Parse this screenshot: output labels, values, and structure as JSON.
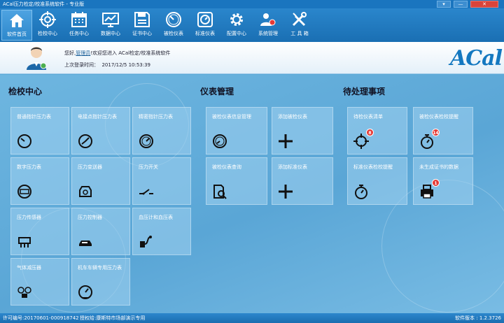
{
  "window": {
    "title": "ACal压力检定/校准系统软件 - 专业版",
    "controls": [
      "▾",
      "—",
      "✕"
    ]
  },
  "toolbar": [
    {
      "label": "软件首页",
      "icon": "home-icon",
      "active": true
    },
    {
      "label": "检校中心",
      "icon": "target-icon"
    },
    {
      "label": "任务中心",
      "icon": "calendar-icon"
    },
    {
      "label": "数据中心",
      "icon": "monitor-chart-icon"
    },
    {
      "label": "证书中心",
      "icon": "floppy-icon"
    },
    {
      "label": "被检仪表",
      "icon": "gauge-icon"
    },
    {
      "label": "标准仪表",
      "icon": "standard-gauge-icon"
    },
    {
      "label": "配置中心",
      "icon": "gear-icon"
    },
    {
      "label": "系统管理",
      "icon": "users-icon"
    },
    {
      "label": "工 具 箱",
      "icon": "tools-icon"
    }
  ],
  "header": {
    "greeting": "您好,",
    "username": "管理员",
    "welcome": "!欢迎您进入 ACal检定/校准系统软件",
    "last_login_label": "上次登录时间：",
    "last_login_value": "2017/12/5 10:53:39",
    "logo": "ACal"
  },
  "sections": {
    "calibration": {
      "title": "检校中心",
      "tiles": [
        {
          "label": "普通指针压力表",
          "icon": "pointer-gauge-icon"
        },
        {
          "label": "电接点指针压力表",
          "icon": "contact-gauge-icon"
        },
        {
          "label": "精密指针压力表",
          "icon": "precision-gauge-icon"
        },
        {
          "label": "数字压力表",
          "icon": "digital-gauge-icon"
        },
        {
          "label": "压力变送器",
          "icon": "transmitter-icon"
        },
        {
          "label": "压力开关",
          "icon": "switch-icon"
        },
        {
          "label": "压力传感器",
          "icon": "sensor-icon"
        },
        {
          "label": "压力控制器",
          "icon": "controller-icon"
        },
        {
          "label": "血压计和血压表",
          "icon": "blood-pressure-icon"
        },
        {
          "label": "气体减压器",
          "icon": "reducer-icon"
        },
        {
          "label": "机车车辆专用压力表",
          "icon": "locomotive-gauge-icon"
        }
      ]
    },
    "instruments": {
      "title": "仪表管理",
      "tiles": [
        {
          "label": "被检仪表信息管理",
          "icon": "gauge-info-icon"
        },
        {
          "label": "添加被检仪表",
          "icon": "plus-icon"
        },
        {
          "label": "被检仪表查询",
          "icon": "search-doc-icon"
        },
        {
          "label": "添加标准仪表",
          "icon": "plus-icon"
        }
      ]
    },
    "pending": {
      "title": "待处理事项",
      "tiles": [
        {
          "label": "待检仪表清单",
          "icon": "crosshair-icon",
          "badge": "8"
        },
        {
          "label": "被检仪表检校提醒",
          "icon": "stopwatch-icon",
          "badge": "14"
        },
        {
          "label": "标准仪表检校提醒",
          "icon": "stopwatch-icon"
        },
        {
          "label": "未生成证书的数据",
          "icon": "printer-icon",
          "badge": "1"
        }
      ]
    }
  },
  "statusbar": {
    "license": "许可编号:20170601-000918742",
    "authorized": "授权给:康斯特市场部演示专用",
    "version": "软件版本 : 1.2.3726"
  }
}
